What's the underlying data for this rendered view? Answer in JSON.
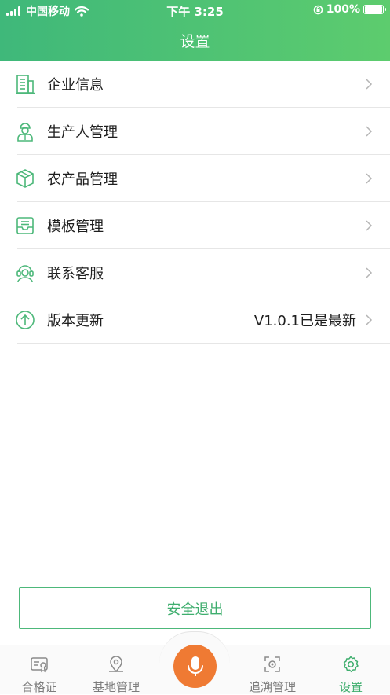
{
  "status_bar": {
    "carrier": "中国移动",
    "time": "下午 3:25",
    "battery": "100%"
  },
  "header": {
    "title": "设置"
  },
  "menu": [
    {
      "label": "企业信息",
      "icon": "building-icon"
    },
    {
      "label": "生产人管理",
      "icon": "worker-icon"
    },
    {
      "label": "农产品管理",
      "icon": "box-icon"
    },
    {
      "label": "模板管理",
      "icon": "inbox-tray-icon"
    },
    {
      "label": "联系客服",
      "icon": "headset-icon"
    },
    {
      "label": "版本更新",
      "icon": "arrow-up-circle-icon",
      "value": "V1.0.1已是最新"
    }
  ],
  "logout": {
    "label": "安全退出"
  },
  "tabbar": {
    "tabs": [
      {
        "label": "合格证",
        "icon": "certificate-icon"
      },
      {
        "label": "基地管理",
        "icon": "map-pin-icon"
      },
      {
        "label": "追溯管理",
        "icon": "scan-icon"
      },
      {
        "label": "设置",
        "icon": "gear-icon",
        "active": true
      }
    ],
    "center": {
      "icon": "microphone-icon"
    }
  },
  "colors": {
    "brand_green": "#4cc070",
    "accent_orange": "#ef7a33",
    "icon_green": "#4db87a"
  }
}
